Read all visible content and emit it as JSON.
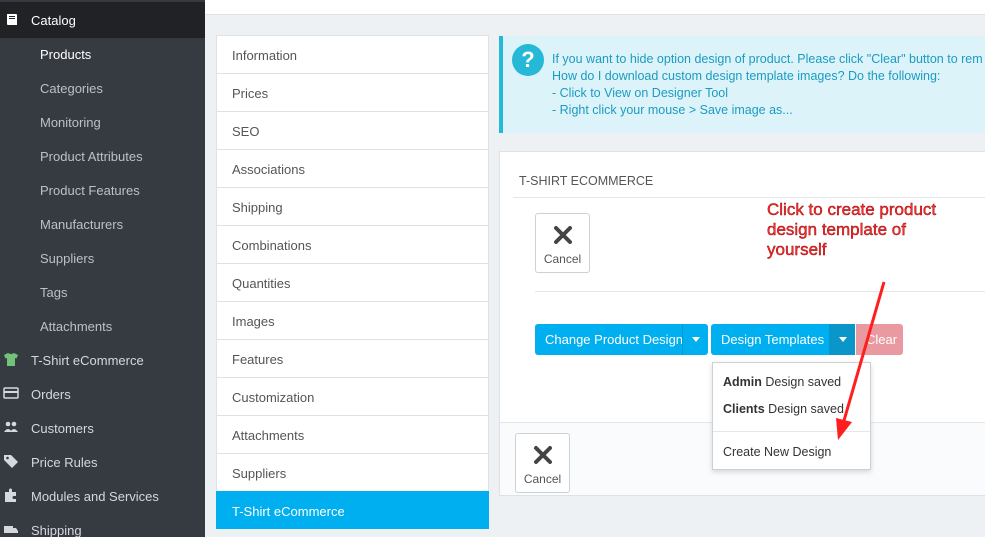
{
  "sidebar": {
    "catalog_label": "Catalog",
    "sub_items": [
      {
        "label": "Products",
        "active": true
      },
      {
        "label": "Categories"
      },
      {
        "label": "Monitoring"
      },
      {
        "label": "Product Attributes"
      },
      {
        "label": "Product Features"
      },
      {
        "label": "Manufacturers"
      },
      {
        "label": "Suppliers"
      },
      {
        "label": "Tags"
      },
      {
        "label": "Attachments"
      }
    ],
    "main_items": [
      {
        "label": "T-Shirt eCommerce",
        "icon": "tshirt-icon"
      },
      {
        "label": "Orders",
        "icon": "credit-card-icon"
      },
      {
        "label": "Customers",
        "icon": "users-icon"
      },
      {
        "label": "Price Rules",
        "icon": "tag-icon"
      },
      {
        "label": "Modules and Services",
        "icon": "puzzle-icon"
      },
      {
        "label": "Shipping",
        "icon": "truck-icon"
      }
    ]
  },
  "tabs": [
    "Information",
    "Prices",
    "SEO",
    "Associations",
    "Shipping",
    "Combinations",
    "Quantities",
    "Images",
    "Features",
    "Customization",
    "Attachments",
    "Suppliers",
    "T-Shirt eCommerce"
  ],
  "active_tab": "T-Shirt eCommerce",
  "info": {
    "line1": "If you want to hide option design of product. Please click \"Clear\" button to rem",
    "line2": "How do I download custom design template images? Do the following:",
    "line3": "- Click to View on Designer Tool",
    "line4": "- Right click your mouse > Save image as..."
  },
  "panel": {
    "title": "T-SHIRT ECOMMERCE",
    "cancel_label": "Cancel",
    "change_design_label": "Change Product Design",
    "design_templates_label": "Design Templates",
    "clear_label": "Clear",
    "footer_cancel_label": "Cancel"
  },
  "dropdown": {
    "items": [
      {
        "bold": "Admin",
        "rest": "Design saved"
      },
      {
        "bold": "Clients",
        "rest": "Design saved"
      }
    ],
    "create_label": "Create New Design"
  },
  "annotation": {
    "line1": "Click to create product",
    "line2": "design template of",
    "line3": "yourself"
  },
  "colors": {
    "accent": "#00aff0",
    "sidebar": "#363a41",
    "annotation": "#ff2a2a"
  }
}
